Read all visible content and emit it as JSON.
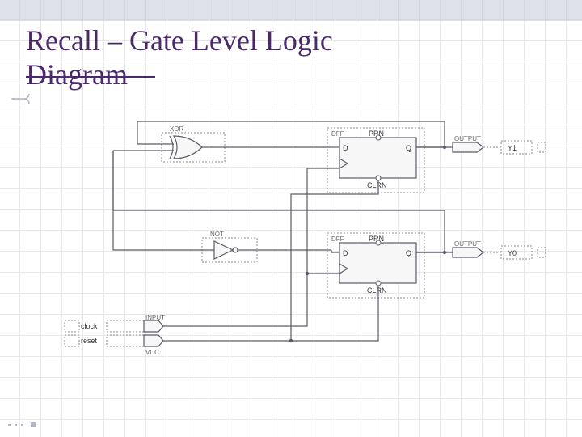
{
  "title_line1": "Recall – Gate Level Logic",
  "title_line2": "Diagram",
  "gates": {
    "xor": {
      "label": "XOR"
    },
    "not": {
      "label": "NOT"
    }
  },
  "ff1": {
    "d": "D",
    "q": "Q",
    "prn": "PRN",
    "clrn": "CLRN",
    "type": "DFF"
  },
  "ff0": {
    "d": "D",
    "q": "Q",
    "prn": "PRN",
    "clrn": "CLRN",
    "type": "DFF"
  },
  "outputs": {
    "label": "OUTPUT",
    "y1": "Y1",
    "y0": "Y0"
  },
  "inputs": {
    "clock": "clock",
    "reset": "reset",
    "tag": "INPUT",
    "vcc": "VCC"
  },
  "pin_dummy": {
    "blank": ""
  }
}
